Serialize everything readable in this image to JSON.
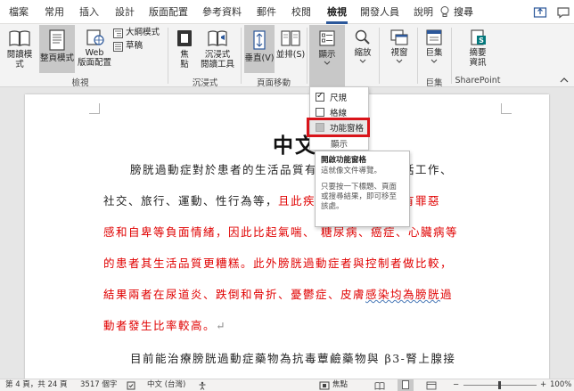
{
  "tabs": [
    "檔案",
    "常用",
    "插入",
    "設計",
    "版面配置",
    "參考資料",
    "郵件",
    "校閱",
    "檢視",
    "開發人員",
    "說明"
  ],
  "active_tab": "檢視",
  "tell_me": "搜尋",
  "ribbon": {
    "views": {
      "read_mode": "閱讀模式",
      "print_layout": "整頁模式",
      "web_layout_1": "Web",
      "web_layout_2": "版面配置",
      "outline": "大綱模式",
      "draft": "草稿",
      "label": "檢視"
    },
    "immersive": {
      "focus_1": "焦",
      "focus_2": "點",
      "reader_1": "沉浸式",
      "reader_2": "閱讀工具",
      "label": "沉浸式"
    },
    "page_movement": {
      "vertical": "垂直(V)",
      "side_by_side": "並排(S)",
      "label": "頁面移動"
    },
    "show": {
      "label": "顯示"
    },
    "zoom": {
      "label": "縮放"
    },
    "window": {
      "label": "視窗"
    },
    "macros": {
      "label": "巨集",
      "group": "巨集"
    },
    "sharepoint": {
      "properties_1": "摘要",
      "properties_2": "資訊",
      "group": "SharePoint"
    }
  },
  "show_menu": {
    "ruler": "尺規",
    "gridlines": "格線",
    "navigation_pane": "功能窗格",
    "footer": "顯示",
    "ruler_checked": true,
    "gridlines_checked": false
  },
  "tooltip": {
    "title": "開啟功能窗格",
    "line1": "這就像文件導覽。",
    "line2": "只要按一下標題、頁面或搜尋結果，即可移至該處。"
  },
  "document": {
    "title_visible": "中文摘",
    "l1_a": "膀胱過動症對於患者的生活品質有",
    "l1_b": "括工作、",
    "l2_a": "社交、旅行、運動、性行為等，",
    "l2_b": "且此疾",
    "l2_c": "具有罪惡",
    "l3_a": "感和自卑等負面情緒，因此比起氣喘、",
    "l3_b": "糖尿病",
    "l3_c": "、癌症、心臟病等",
    "l4": "的患者其生活品質更糟糕。此外膀胱過動症者與控制者做比較，",
    "l5_a": "結果兩者在尿道炎、跌倒和骨折、憂鬱症、皮膚",
    "l5_b": "感染均為膀胱",
    "l5_c": "過",
    "l6_a": "動者發生比率較高。",
    "l6_b": "↵",
    "l7": "目前能治療膀胱過動症藥物為抗毒蕈鹼藥物與 β3-腎上腺接"
  },
  "status": {
    "page": "第 4 頁，共 24 頁",
    "words": "3517 個字",
    "language": "中文 (台灣)",
    "focus": "焦點",
    "zoom": "100%"
  },
  "colors": {
    "accent": "#2b579a",
    "red_text": "#e00000",
    "highlight_box": "#d9141a"
  }
}
